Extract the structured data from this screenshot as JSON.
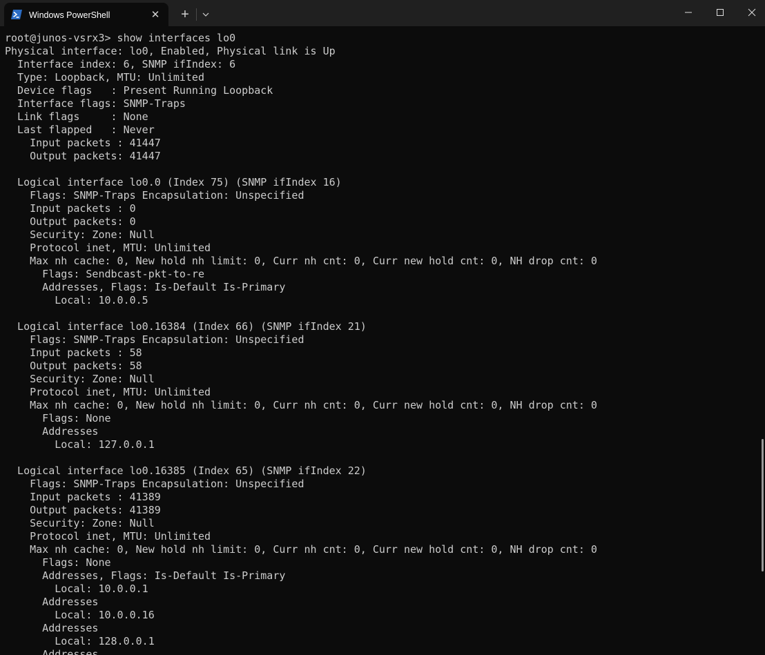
{
  "window": {
    "tab_title": "Windows PowerShell",
    "tab_close_glyph": "✕",
    "newtab_glyph": "+",
    "icons": {
      "tab": "powershell-icon",
      "dropdown": "chevron-down-icon",
      "minimize": "minimize-icon",
      "maximize": "maximize-icon",
      "close": "close-icon"
    }
  },
  "colors": {
    "background": "#0c0c0c",
    "titlebar": "#202020",
    "text": "#cccccc",
    "powershell_icon": "#2b6cc4"
  },
  "terminal": {
    "lines": [
      "root@junos-vsrx3> show interfaces lo0",
      "Physical interface: lo0, Enabled, Physical link is Up",
      "  Interface index: 6, SNMP ifIndex: 6",
      "  Type: Loopback, MTU: Unlimited",
      "  Device flags   : Present Running Loopback",
      "  Interface flags: SNMP-Traps",
      "  Link flags     : None",
      "  Last flapped   : Never",
      "    Input packets : 41447",
      "    Output packets: 41447",
      "",
      "  Logical interface lo0.0 (Index 75) (SNMP ifIndex 16)",
      "    Flags: SNMP-Traps Encapsulation: Unspecified",
      "    Input packets : 0",
      "    Output packets: 0",
      "    Security: Zone: Null",
      "    Protocol inet, MTU: Unlimited",
      "    Max nh cache: 0, New hold nh limit: 0, Curr nh cnt: 0, Curr new hold cnt: 0, NH drop cnt: 0",
      "      Flags: Sendbcast-pkt-to-re",
      "      Addresses, Flags: Is-Default Is-Primary",
      "        Local: 10.0.0.5",
      "",
      "  Logical interface lo0.16384 (Index 66) (SNMP ifIndex 21)",
      "    Flags: SNMP-Traps Encapsulation: Unspecified",
      "    Input packets : 58",
      "    Output packets: 58",
      "    Security: Zone: Null",
      "    Protocol inet, MTU: Unlimited",
      "    Max nh cache: 0, New hold nh limit: 0, Curr nh cnt: 0, Curr new hold cnt: 0, NH drop cnt: 0",
      "      Flags: None",
      "      Addresses",
      "        Local: 127.0.0.1",
      "",
      "  Logical interface lo0.16385 (Index 65) (SNMP ifIndex 22)",
      "    Flags: SNMP-Traps Encapsulation: Unspecified",
      "    Input packets : 41389",
      "    Output packets: 41389",
      "    Security: Zone: Null",
      "    Protocol inet, MTU: Unlimited",
      "    Max nh cache: 0, New hold nh limit: 0, Curr nh cnt: 0, Curr new hold cnt: 0, NH drop cnt: 0",
      "      Flags: None",
      "      Addresses, Flags: Is-Default Is-Primary",
      "        Local: 10.0.0.1",
      "      Addresses",
      "        Local: 10.0.0.16",
      "      Addresses",
      "        Local: 128.0.0.1",
      "      Addresses"
    ]
  }
}
